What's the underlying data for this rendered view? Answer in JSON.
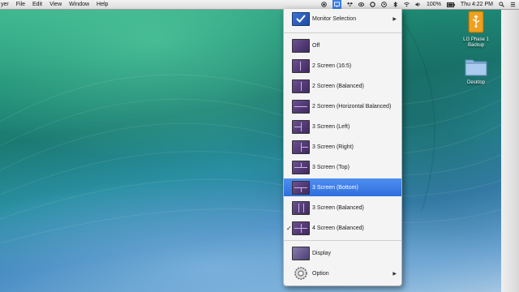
{
  "menubar": {
    "app_partial": "yer",
    "menus": [
      "File",
      "Edit",
      "View",
      "Window",
      "Help"
    ],
    "status": {
      "battery": "100%",
      "clock": "Thu 4:22 PM"
    }
  },
  "menu": {
    "header_label": "Monitor Selection",
    "items": [
      {
        "label": "Off"
      },
      {
        "label": "2 Screen (16:5)"
      },
      {
        "label": "2 Screen (Balanced)"
      },
      {
        "label": "2 Screen (Horizontal Balanced)"
      },
      {
        "label": "3 Screen (Left)"
      },
      {
        "label": "3 Screen (Right)"
      },
      {
        "label": "3 Screen (Top)"
      },
      {
        "label": "3 Screen (Bottom)"
      },
      {
        "label": "3 Screen (Balanced)"
      },
      {
        "label": "4 Screen (Balanced)",
        "checked": "✓"
      }
    ],
    "display_label": "Display",
    "option_label": "Option",
    "submenu_arrow": "▶"
  },
  "desktop_icons": [
    {
      "label_line1": "LG Phase 1",
      "label_line2": "Backup",
      "icon": "usb-drive-icon"
    },
    {
      "label_line1": "Desktop",
      "icon": "folder-icon"
    }
  ],
  "colors": {
    "highlight": "#3a7de0",
    "thumb": "#5a3f80"
  }
}
